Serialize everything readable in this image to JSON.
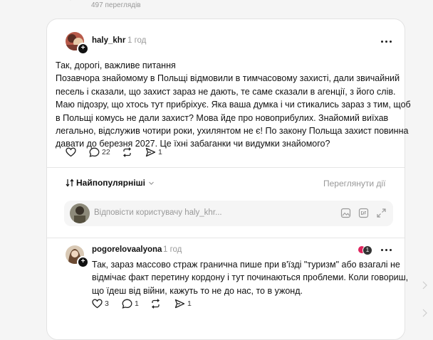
{
  "top": {
    "views": "497 переглядів"
  },
  "post": {
    "username": "haly_khr",
    "time": "1 год",
    "lines": [
      "Так, дорогі, важливе питання",
      "Позавчора знайомому в Польщі відмовили в тимчасовому захисті, дали звичайний",
      "песель і сказали, що захист зараз не дають, те саме сказали в агенції, з його слів.",
      "Маю підозру, що хтось тут прибріхує. Яка ваша думка і чи стикались зараз з тим, щоб",
      "в Польщі комусь не дали захист? Мова йде про новоприбулих. Знайомий виїхав",
      "легально, відслужив чотири роки, ухилянтом не є! По закону Польща захист повинна",
      "давати до березня 2027. Це їхні забаганки чи видумки знайомого?"
    ],
    "actions": {
      "likes": "",
      "comments": "22",
      "reposts": "",
      "shares": "1"
    }
  },
  "sort": {
    "label": "Найпопулярніші",
    "activity_link": "Переглянути дії"
  },
  "reply": {
    "placeholder": "Відповісти користувачу haly_khr..."
  },
  "comment": {
    "username": "pogorelovaalyona",
    "time": "1 год",
    "lines": [
      "Так, зараз массово страж гранична пише при в'їзді \"туризм\" або взагалі не",
      "відмічає факт перетину кордону і тут починаються проблеми. Коли говориш,",
      "що їдеш від війни, кажуть то не до нас, то в ужонд."
    ],
    "actions": {
      "likes": "3",
      "comments": "1",
      "reposts": "",
      "shares": "1"
    },
    "reactions_badge": "1"
  },
  "colors": {
    "badge_red": "#e0245e",
    "muted": "#999999",
    "accent": "#111111"
  },
  "icons": {
    "heart": "heart-icon",
    "comment": "comment-icon",
    "repost": "repost-icon",
    "share": "share-icon",
    "more": "more-icon",
    "image": "image-icon",
    "gif": "gif-icon",
    "expand": "expand-icon",
    "sort": "sort-icon"
  }
}
